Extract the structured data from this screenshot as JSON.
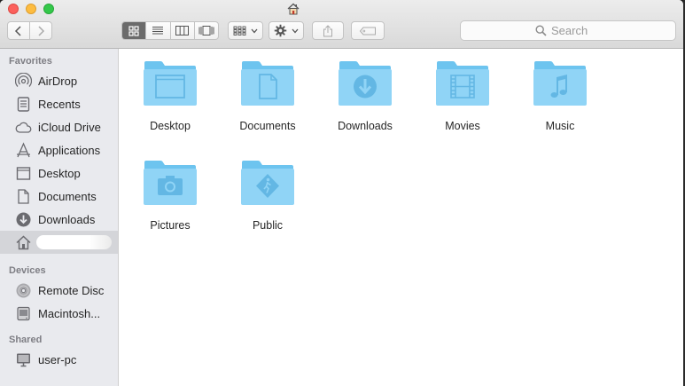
{
  "window": {
    "title_icon": "home-icon"
  },
  "toolbar": {
    "back_icon": "chevron-left-icon",
    "forward_icon": "chevron-right-icon",
    "views": [
      "icon-view-icon",
      "list-view-icon",
      "column-view-icon",
      "cover-flow-view-icon"
    ],
    "active_view": "icon-view-icon",
    "arrange_icon": "arrange-grid-icon",
    "action_icon": "gear-icon",
    "share_icon": "share-icon",
    "tag_icon": "tag-icon"
  },
  "search": {
    "placeholder": "Search"
  },
  "sidebar": {
    "favorites_title": "Favorites",
    "favorites": [
      {
        "label": "AirDrop",
        "icon": "airdrop-icon"
      },
      {
        "label": "Recents",
        "icon": "recents-icon"
      },
      {
        "label": "iCloud Drive",
        "icon": "cloud-icon"
      },
      {
        "label": "Applications",
        "icon": "applications-icon"
      },
      {
        "label": "Desktop",
        "icon": "desktop-icon"
      },
      {
        "label": "Documents",
        "icon": "document-icon"
      },
      {
        "label": "Downloads",
        "icon": "download-icon"
      }
    ],
    "home_item": {
      "icon": "home-icon",
      "selected": true
    },
    "devices_title": "Devices",
    "devices": [
      {
        "label": "Remote Disc",
        "icon": "disc-icon"
      },
      {
        "label": "Macintosh...",
        "icon": "hard-drive-icon"
      }
    ],
    "shared_title": "Shared",
    "shared": [
      {
        "label": "user-pc",
        "icon": "computer-icon"
      }
    ]
  },
  "content": {
    "items": [
      {
        "name": "Desktop",
        "glyph": "desktop-glyph"
      },
      {
        "name": "Documents",
        "glyph": "document-glyph"
      },
      {
        "name": "Downloads",
        "glyph": "download-glyph"
      },
      {
        "name": "Movies",
        "glyph": "film-glyph"
      },
      {
        "name": "Music",
        "glyph": "music-note-glyph"
      },
      {
        "name": "Pictures",
        "glyph": "camera-glyph"
      },
      {
        "name": "Public",
        "glyph": "public-glyph"
      }
    ]
  },
  "colors": {
    "folder_back": "#6dc4ef",
    "folder_front": "#90d4f6",
    "folder_glyph": "#63b7e4",
    "sidebar_bg": "#e9eaee",
    "sidebar_selected": "#d4d5d9",
    "active_segment": "#6b6b6b"
  }
}
